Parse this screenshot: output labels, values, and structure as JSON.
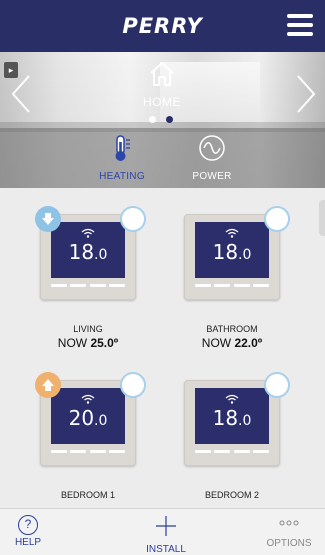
{
  "header": {
    "logo_text": "PERRY",
    "menu_icon": "hamburger-icon"
  },
  "hero": {
    "title": "HOME",
    "home_icon": "house-icon",
    "prev_icon": "chevron-left-icon",
    "next_icon": "chevron-right-icon",
    "slide_count": 2,
    "active_slide": 2
  },
  "modes": [
    {
      "label": "HEATING",
      "icon": "thermometer-icon",
      "color": "#2c45a8",
      "active": true
    },
    {
      "label": "POWER",
      "icon": "sine-wave-icon",
      "color": "#ffffff",
      "active": false
    }
  ],
  "thermostats": [
    {
      "room": "LIVING",
      "setpoint": "18",
      "decimal": ".0",
      "now_prefix": "NOW",
      "now_value": "25.0º",
      "badge": "down"
    },
    {
      "room": "BATHROOM",
      "setpoint": "18",
      "decimal": ".0",
      "now_prefix": "NOW",
      "now_value": "22.0º",
      "badge": ""
    },
    {
      "room": "BEDROOM 1",
      "setpoint": "20",
      "decimal": ".0",
      "now_prefix": "",
      "now_value": "",
      "badge": "up"
    },
    {
      "room": "BEDROOM 2",
      "setpoint": "18",
      "decimal": ".0",
      "now_prefix": "",
      "now_value": "",
      "badge": ""
    }
  ],
  "footer": {
    "help": {
      "label": "HELP",
      "icon": "help-circle-icon"
    },
    "install": {
      "label": "INSTALL",
      "icon": "plus-icon"
    },
    "options": {
      "label": "OPTIONS",
      "icon": "ellipsis-icon"
    }
  },
  "colors": {
    "brand": "#2a2e66",
    "screen": "#2b2e6b",
    "accent_blue": "#2c45a8",
    "badge_cool": "#8ec3e6",
    "badge_warm": "#f0b06e"
  }
}
